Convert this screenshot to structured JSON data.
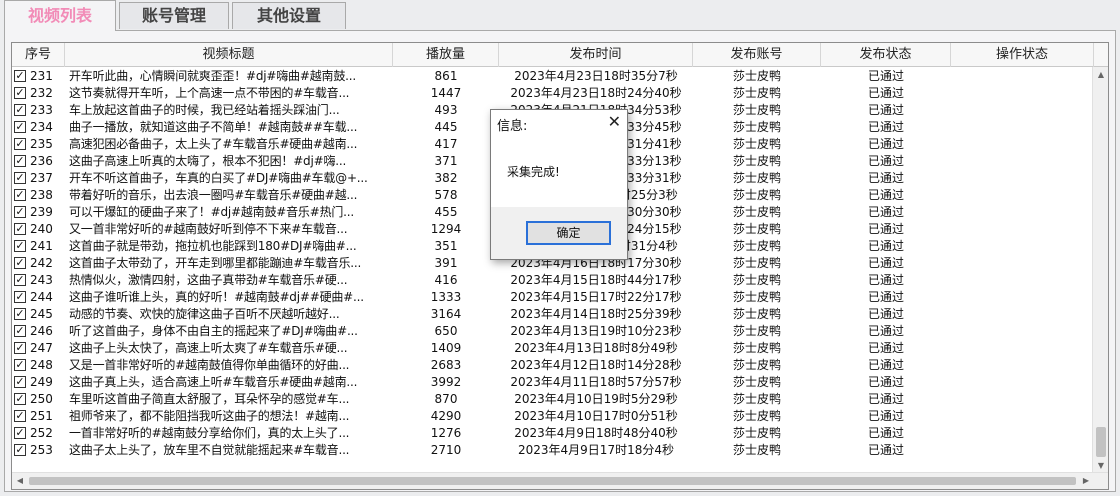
{
  "tabs": [
    {
      "label": "视频列表"
    },
    {
      "label": "账号管理"
    },
    {
      "label": "其他设置"
    }
  ],
  "table": {
    "columns": [
      "序号",
      "视频标题",
      "播放量",
      "发布时间",
      "发布账号",
      "发布状态",
      "操作状态"
    ],
    "rows": [
      {
        "idx": "231",
        "title": "开车听此曲，心情瞬间就爽歪歪！#dj#嗨曲#越南鼓...",
        "views": "861",
        "date": "2023年4月23日18时35分7秒",
        "account": "莎士皮鸭",
        "status": "已通过",
        "op": ""
      },
      {
        "idx": "232",
        "title": "这节奏就得开车听，上个高速一点不带困的#车载音...",
        "views": "1447",
        "date": "2023年4月23日18时24分40秒",
        "account": "莎士皮鸭",
        "status": "已通过",
        "op": ""
      },
      {
        "idx": "233",
        "title": "车上放起这首曲子的时候，我已经站着摇头踩油门...",
        "views": "493",
        "date": "2023年4月21日18时34分53秒",
        "account": "莎士皮鸭",
        "status": "已通过",
        "op": ""
      },
      {
        "idx": "234",
        "title": "曲子一播放，就知道这曲子不简单！#越南鼓##车载...",
        "views": "445",
        "date": "2023年4月20日18时33分45秒",
        "account": "莎士皮鸭",
        "status": "已通过",
        "op": ""
      },
      {
        "idx": "235",
        "title": "高速犯困必备曲子，太上头了#车载音乐#硬曲#越南...",
        "views": "417",
        "date": "2023年4月19日18时31分41秒",
        "account": "莎士皮鸭",
        "status": "已通过",
        "op": ""
      },
      {
        "idx": "236",
        "title": "这曲子高速上听真的太嗨了，根本不犯困！#dj#嗨...",
        "views": "371",
        "date": "2023年4月19日18时33分13秒",
        "account": "莎士皮鸭",
        "status": "已通过",
        "op": ""
      },
      {
        "idx": "237",
        "title": "开车不听这首曲子，车真的白买了#DJ#嗨曲#车载@+...",
        "views": "382",
        "date": "2023年4月18日18时33分31秒",
        "account": "莎士皮鸭",
        "status": "已通过",
        "op": ""
      },
      {
        "idx": "238",
        "title": "带着好听的音乐，出去浪一圈吗#车载音乐#硬曲#越...",
        "views": "578",
        "date": "2023年4月18日18时25分3秒",
        "account": "莎士皮鸭",
        "status": "已通过",
        "op": ""
      },
      {
        "idx": "239",
        "title": "可以干爆缸的硬曲子来了！#dj#越南鼓#音乐#热门...",
        "views": "455",
        "date": "2023年4月17日18时30分30秒",
        "account": "莎士皮鸭",
        "status": "已通过",
        "op": ""
      },
      {
        "idx": "240",
        "title": "又一首非常好听的#越南鼓好听到停不下来#车载音...",
        "views": "1294",
        "date": "2023年4月17日18时24分15秒",
        "account": "莎士皮鸭",
        "status": "已通过",
        "op": ""
      },
      {
        "idx": "241",
        "title": "这首曲子就是带劲，拖拉机也能踩到180#DJ#嗨曲#...",
        "views": "351",
        "date": "2023年4月16日18时31分4秒",
        "account": "莎士皮鸭",
        "status": "已通过",
        "op": ""
      },
      {
        "idx": "242",
        "title": "这首曲子太带劲了，开车走到哪里都能蹦迪#车载音乐...",
        "views": "391",
        "date": "2023年4月16日18时17分30秒",
        "account": "莎士皮鸭",
        "status": "已通过",
        "op": ""
      },
      {
        "idx": "243",
        "title": "热情似火，激情四射，这曲子真带劲#车载音乐#硬...",
        "views": "416",
        "date": "2023年4月15日18时44分17秒",
        "account": "莎士皮鸭",
        "status": "已通过",
        "op": ""
      },
      {
        "idx": "244",
        "title": "这曲子谁听谁上头，真的好听！#越南鼓#dj##硬曲#...",
        "views": "1333",
        "date": "2023年4月15日17时22分17秒",
        "account": "莎士皮鸭",
        "status": "已通过",
        "op": ""
      },
      {
        "idx": "245",
        "title": "动感的节奏、欢快的旋律这曲子百听不厌越听越好...",
        "views": "3164",
        "date": "2023年4月14日18时25分39秒",
        "account": "莎士皮鸭",
        "status": "已通过",
        "op": ""
      },
      {
        "idx": "246",
        "title": "听了这首曲子，身体不由自主的摇起来了#DJ#嗨曲#...",
        "views": "650",
        "date": "2023年4月13日19时10分23秒",
        "account": "莎士皮鸭",
        "status": "已通过",
        "op": ""
      },
      {
        "idx": "247",
        "title": "这曲子上头太快了，高速上听太爽了#车载音乐#硬...",
        "views": "1409",
        "date": "2023年4月13日18时8分49秒",
        "account": "莎士皮鸭",
        "status": "已通过",
        "op": ""
      },
      {
        "idx": "248",
        "title": "又是一首非常好听的#越南鼓值得你单曲循环的好曲...",
        "views": "2683",
        "date": "2023年4月12日18时14分28秒",
        "account": "莎士皮鸭",
        "status": "已通过",
        "op": ""
      },
      {
        "idx": "249",
        "title": "这曲子真上头，适合高速上听#车载音乐#硬曲#越南...",
        "views": "3992",
        "date": "2023年4月11日18时57分57秒",
        "account": "莎士皮鸭",
        "status": "已通过",
        "op": ""
      },
      {
        "idx": "250",
        "title": "车里听这首曲子简直太舒服了，耳朵怀孕的感觉#车...",
        "views": "870",
        "date": "2023年4月10日19时5分29秒",
        "account": "莎士皮鸭",
        "status": "已通过",
        "op": ""
      },
      {
        "idx": "251",
        "title": "祖师爷来了，都不能阻挡我听这曲子的想法！#越南...",
        "views": "4290",
        "date": "2023年4月10日17时0分51秒",
        "account": "莎士皮鸭",
        "status": "已通过",
        "op": ""
      },
      {
        "idx": "252",
        "title": "一首非常好听的#越南鼓分享给你们，真的太上头了...",
        "views": "1276",
        "date": "2023年4月9日18时48分40秒",
        "account": "莎士皮鸭",
        "status": "已通过",
        "op": ""
      },
      {
        "idx": "253",
        "title": "这曲子太上头了，放车里不自觉就能摇起来#车载音...",
        "views": "2710",
        "date": "2023年4月9日17时18分4秒",
        "account": "莎士皮鸭",
        "status": "已通过",
        "op": ""
      }
    ]
  },
  "dialog": {
    "title": "信息:",
    "message": "采集完成!",
    "ok_label": "确定",
    "close_glyph": "✕"
  },
  "colors": {
    "active_tab_text": "#f28bb7",
    "dialog_button_border": "#2a70d8"
  }
}
